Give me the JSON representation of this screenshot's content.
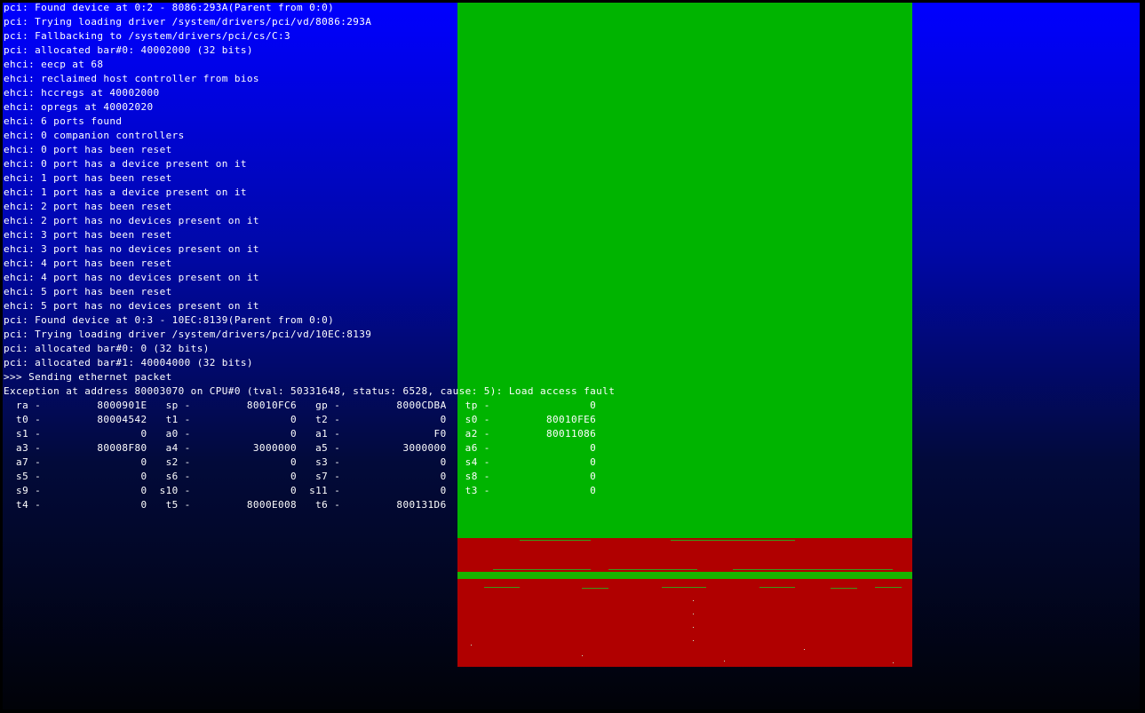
{
  "colors": {
    "background": "#000000",
    "gradient_top": "#0000ff",
    "gradient_bottom": "#010208",
    "green_block": "#00b400",
    "red_block": "#b00000",
    "text": "#ffffff"
  },
  "console": {
    "lines": [
      "pci: Found device at 0:2 - 8086:293A(Parent from 0:0)",
      "pci: Trying loading driver /system/drivers/pci/vd/8086:293A",
      "pci: Fallbacking to /system/drivers/pci/cs/C:3",
      "pci: allocated bar#0: 40002000 (32 bits)",
      "ehci: eecp at 68",
      "ehci: reclaimed host controller from bios",
      "ehci: hccregs at 40002000",
      "ehci: opregs at 40002020",
      "ehci: 6 ports found",
      "ehci: 0 companion controllers",
      "ehci: 0 port has been reset",
      "ehci: 0 port has a device present on it",
      "ehci: 1 port has been reset",
      "ehci: 1 port has a device present on it",
      "ehci: 2 port has been reset",
      "ehci: 2 port has no devices present on it",
      "ehci: 3 port has been reset",
      "ehci: 3 port has no devices present on it",
      "ehci: 4 port has been reset",
      "ehci: 4 port has no devices present on it",
      "ehci: 5 port has been reset",
      "ehci: 5 port has no devices present on it",
      "pci: Found device at 0:3 - 10EC:8139(Parent from 0:0)",
      "pci: Trying loading driver /system/drivers/pci/vd/10EC:8139",
      "pci: allocated bar#0: 0 (32 bits)",
      "pci: allocated bar#1: 40004000 (32 bits)",
      ">>> Sending ethernet packet",
      "Exception at address 80003070 on CPU#0 (tval: 50331648, status: 6528, cause: 5): Load access fault",
      "  ra -         8000901E   sp -         80010FC6   gp -         8000CDBA   tp -                0",
      "  t0 -         80004542   t1 -                0   t2 -                0   s0 -         80010FE6",
      "  s1 -                0   a0 -                0   a1 -               F0   a2 -         80011086",
      "  a3 -         80008F80   a4 -          3000000   a5 -          3000000   a6 -                0",
      "  a7 -                0   s2 -                0   s3 -                0   s4 -                0",
      "  s5 -                0   s6 -                0   s7 -                0   s8 -                0",
      "  s9 -                0  s10 -                0  s11 -                0   t3 -                0",
      "  t4 -                0   t5 -         8000E008   t6 -         800131D6"
    ]
  }
}
